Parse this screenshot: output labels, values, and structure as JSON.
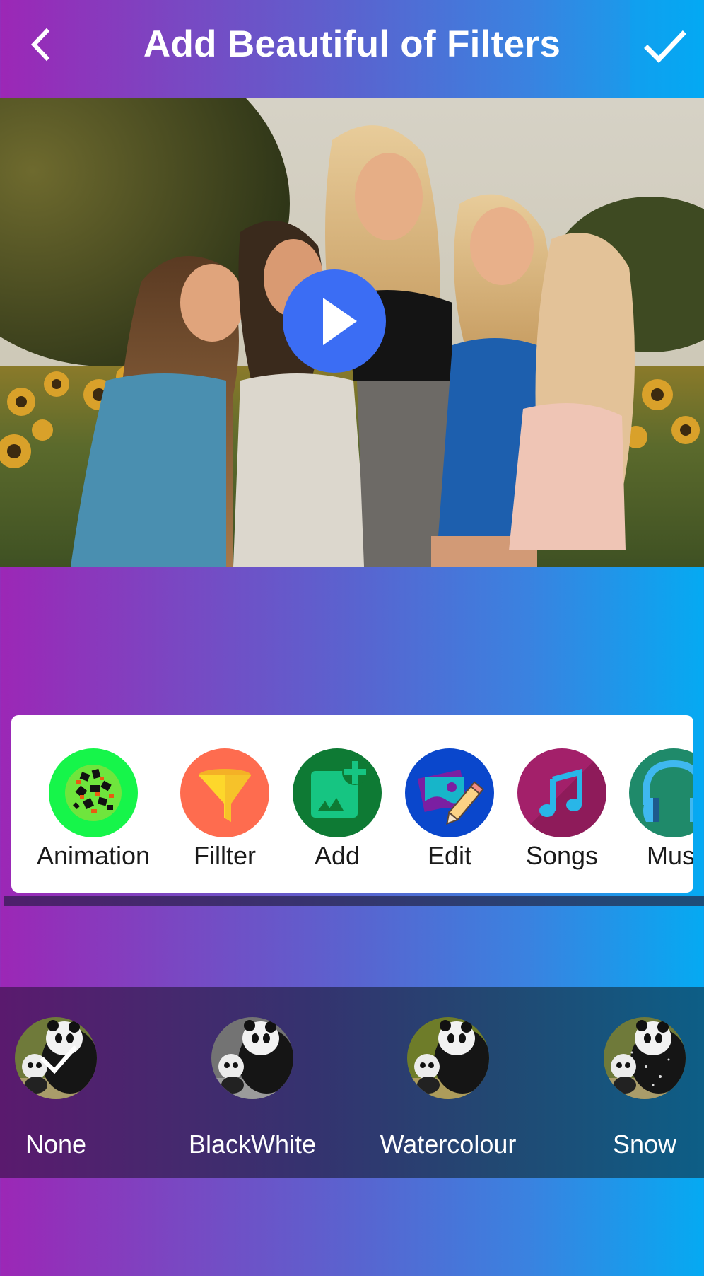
{
  "header": {
    "title": "Add Beautiful of Filters",
    "back_icon": "chevron-left-icon",
    "done_icon": "check-icon"
  },
  "preview": {
    "play_icon": "play-icon",
    "play_color": "#3b6df4"
  },
  "tools": [
    {
      "label": "Animation",
      "icon": "animation-icon",
      "color": "#16f54a"
    },
    {
      "label": "Fillter",
      "icon": "funnel-icon",
      "color": "#fe6c4f"
    },
    {
      "label": "Add",
      "icon": "add-image-icon",
      "color": "#0e7a34"
    },
    {
      "label": "Edit",
      "icon": "edit-photo-icon",
      "color": "#0a47cc"
    },
    {
      "label": "Songs",
      "icon": "music-note-icon",
      "color": "#9b1d60"
    },
    {
      "label": "Musi",
      "icon": "headphones-icon",
      "color": "#1f8a6a"
    }
  ],
  "filters": [
    {
      "label": "None",
      "selected": true,
      "icon": "panda-thumbnail"
    },
    {
      "label": "BlackWhite",
      "selected": false,
      "icon": "panda-thumbnail"
    },
    {
      "label": "Watercolour",
      "selected": false,
      "icon": "panda-thumbnail"
    },
    {
      "label": "Snow",
      "selected": false,
      "icon": "panda-thumbnail"
    }
  ],
  "colors": {
    "gradient_start": "#9c27b6",
    "gradient_end": "#05aaf2"
  }
}
